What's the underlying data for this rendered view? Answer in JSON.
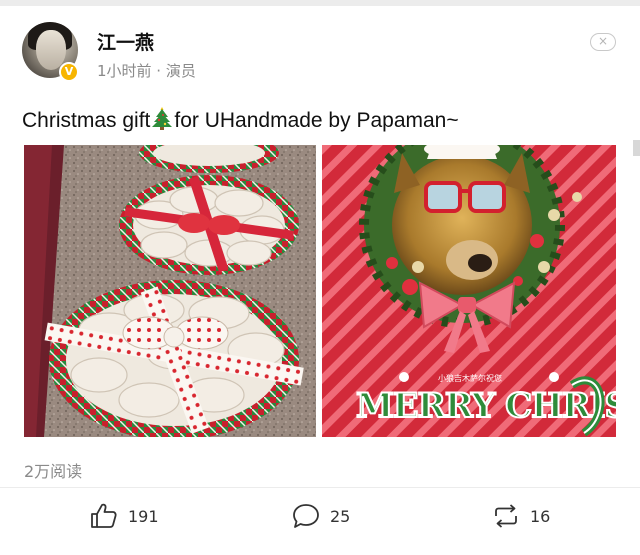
{
  "post": {
    "author": "江一燕",
    "meta": "1小时前 · 演员",
    "verified_badge": "V",
    "close_icon": "×",
    "text_before": "Christmas gift",
    "text_after": "for UHandmade by Papaman~",
    "emoji_icon": "christmas-tree-icon",
    "image_right_caption": "小狼吉木萨尔祝您",
    "image_right_title": "MERRY CHRISTMAS"
  },
  "stats": {
    "reads": "2万阅读"
  },
  "actions": {
    "like_count": "191",
    "comment_count": "25",
    "repost_count": "16"
  },
  "colors": {
    "meta_gray": "#8a8a8a",
    "badge_gold": "#f7b500",
    "stripe_red": "#d22a3a",
    "stripe_pink": "#f06b78"
  }
}
